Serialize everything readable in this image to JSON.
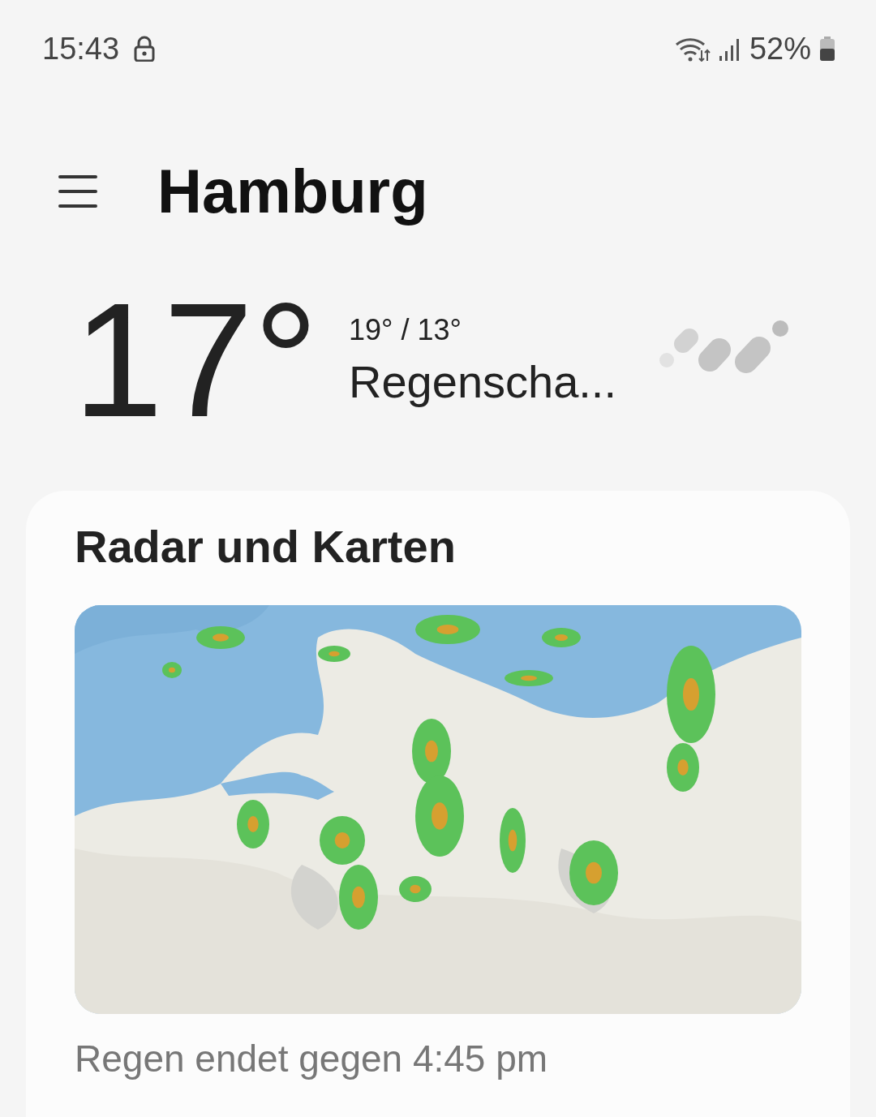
{
  "status_bar": {
    "time": "15:43",
    "battery": "52%"
  },
  "header": {
    "title": "Hamburg"
  },
  "current": {
    "temperature": "17°",
    "high_low": "19° / 13°",
    "condition": "Regenscha..."
  },
  "radar_card": {
    "title": "Radar und Karten",
    "caption": "Regen endet gegen 4:45 pm"
  }
}
